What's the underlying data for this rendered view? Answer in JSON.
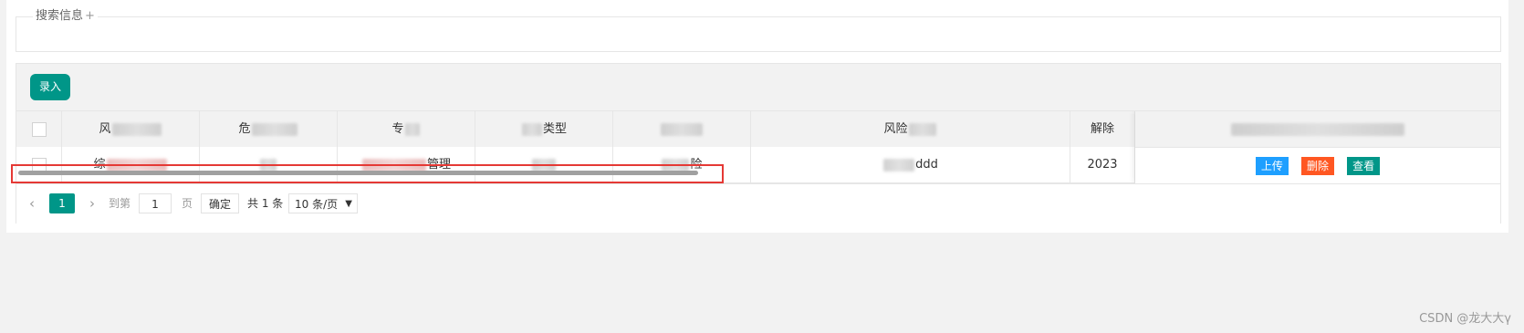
{
  "search": {
    "legend": "搜索信息",
    "expand_icon": "+"
  },
  "toolbar": {
    "add_label": "录入"
  },
  "table": {
    "headers": [
      "风",
      "危",
      "专",
      "类型",
      "",
      "风险",
      "解除",
      ""
    ],
    "row": {
      "col1": "综",
      "col2": "",
      "col3": "管理",
      "col4": "",
      "col5": "险",
      "col6": "ddd",
      "col7": "2023"
    },
    "actions": {
      "upload": "上传",
      "delete": "删除",
      "view": "查看"
    }
  },
  "pager": {
    "prev_icon": "‹",
    "current_page": "1",
    "next_icon": "›",
    "goto_label": "到第",
    "goto_value": "1",
    "page_unit": "页",
    "confirm": "确定",
    "total": "共 1 条",
    "page_size": "10 条/页"
  },
  "watermark": "CSDN @龙大大γ",
  "colors": {
    "primary": "#009688",
    "upload": "#1e9fff",
    "delete": "#ff5722",
    "highlight": "#e53935"
  }
}
